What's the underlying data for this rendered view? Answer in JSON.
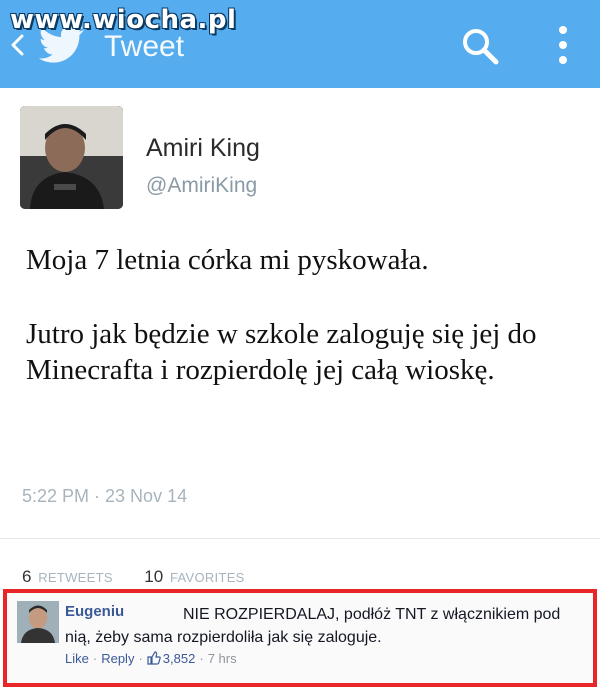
{
  "watermark": "www.wiocha.pl",
  "topbar": {
    "title": "Tweet",
    "background": "#55acee"
  },
  "tweet": {
    "user_name": "Amiri King",
    "user_handle": "@AmiriKing",
    "line1": "Moja 7 letnia córka mi pyskowała.",
    "line2": "Jutro jak będzie w szkole zaloguję się jej do Minecrafta i rozpierdolę jej całą wioskę.",
    "timestamp": "5:22 PM · 23 Nov 14",
    "retweets_count": "6",
    "retweets_label": "RETWEETS",
    "favorites_count": "10",
    "favorites_label": "FAVORITES"
  },
  "comment": {
    "name": "Eugeniu",
    "text": "NIE ROZPIERDALAJ, podłóż TNT z włącznikiem pod nią, żeby sama rozpierdoliła jak się zaloguje.",
    "like_label": "Like",
    "reply_label": "Reply",
    "likes_count": "3,852",
    "time": "7 hrs",
    "border_color": "#e8262a"
  },
  "icons": [
    "back-chevron-icon",
    "twitter-bird-icon",
    "search-icon",
    "more-vert-icon",
    "thumbs-up-icon"
  ]
}
